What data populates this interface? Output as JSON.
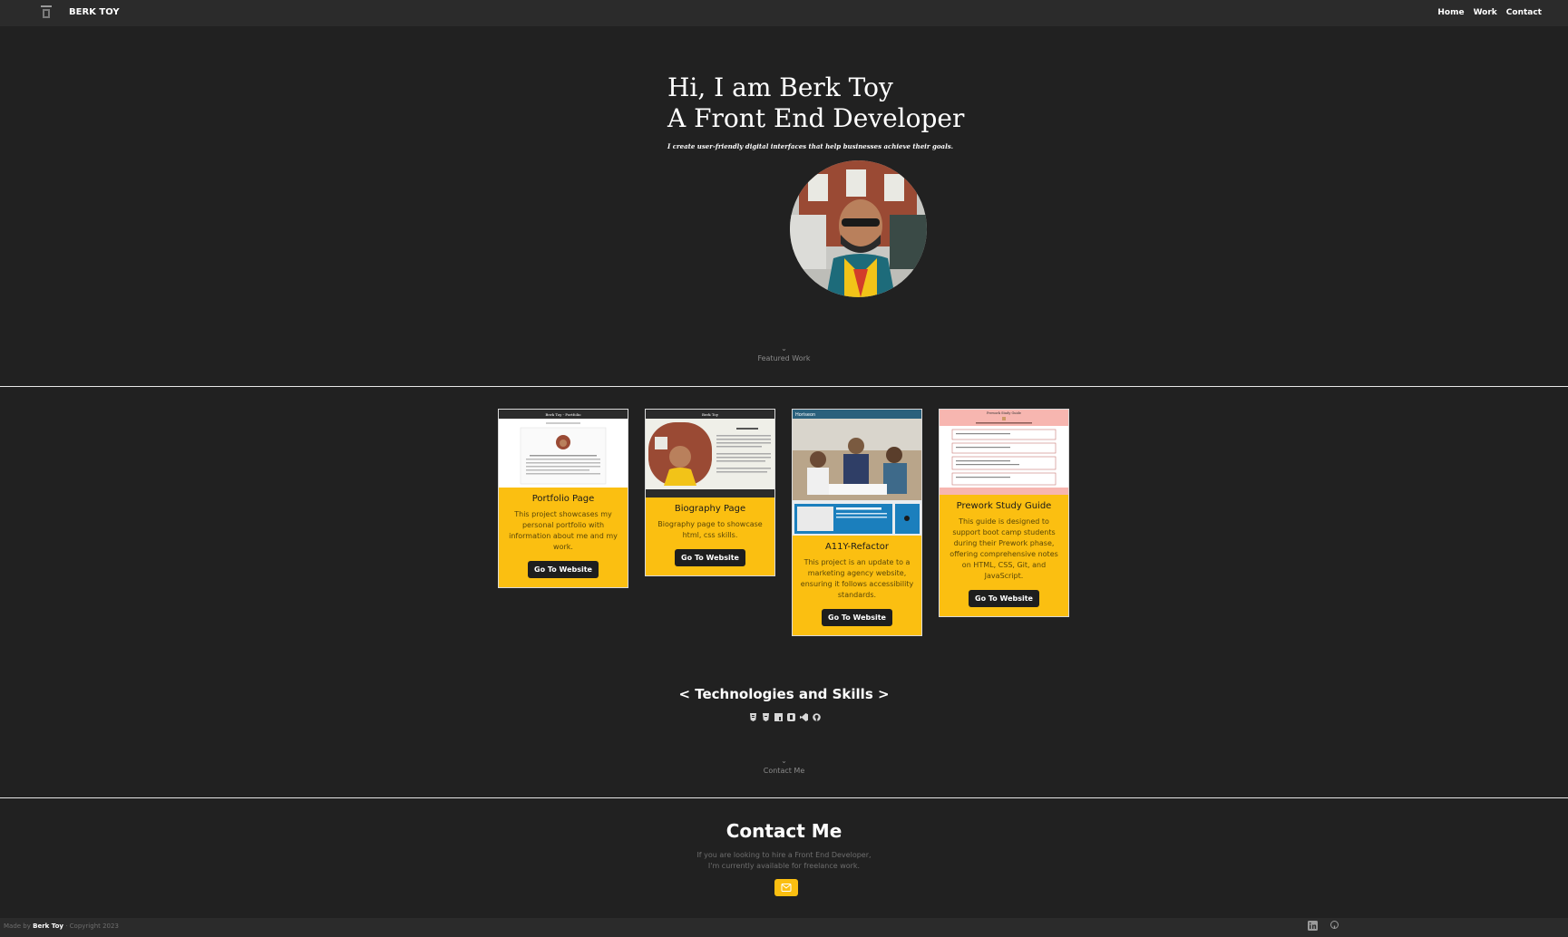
{
  "nav": {
    "brand": "BERK TOY",
    "links": [
      "Home",
      "Work",
      "Contact"
    ]
  },
  "hero": {
    "line1": "Hi, I am Berk Toy",
    "line2": "A Front End Developer",
    "subtitle": "I create user-friendly digital interfaces that help businesses achieve their goals."
  },
  "featured": {
    "label": "Featured Work"
  },
  "projects": [
    {
      "title": "Portfolio Page",
      "description": "This project showcases my personal portfolio with information about me and my work.",
      "button": "Go To Website",
      "thumb_header": "Berk Toy - Portfolio"
    },
    {
      "title": "Biography Page",
      "description": "Biography page to showcase html, css skills.",
      "button": "Go To Website",
      "thumb_header": "Berk Toy"
    },
    {
      "title": "A11Y-Refactor",
      "description": "This project is an update to a marketing agency website, ensuring it follows accessibility standards.",
      "button": "Go To Website",
      "thumb_header": "Horiseon"
    },
    {
      "title": "Prework Study Guide",
      "description": "This guide is designed to support boot camp students during their Prework phase, offering comprehensive notes on HTML, CSS, Git, and JavaScript.",
      "button": "Go To Website",
      "thumb_header": "Prework Study Guide"
    }
  ],
  "skills": {
    "title": "< Technologies and Skills >",
    "icons": [
      "html5-icon",
      "css3-icon",
      "javascript-icon",
      "bootstrap-icon",
      "vscode-icon",
      "github-icon"
    ]
  },
  "contact_cue": {
    "label": "Contact Me"
  },
  "contact": {
    "title": "Contact Me",
    "line1": "If you are looking to hire a Front End Developer,",
    "line2": "I'm currently available for freelance work."
  },
  "footer": {
    "made_by": "Made by",
    "name": "Berk Toy",
    "copyright": "· Copyright 2023"
  },
  "colors": {
    "background": "#212121",
    "navbar": "#2b2b2b",
    "accent": "#fbbf11",
    "button": "#1e1e1e"
  }
}
